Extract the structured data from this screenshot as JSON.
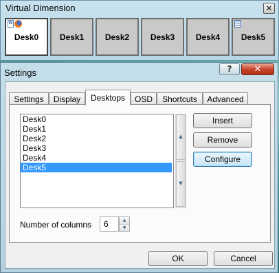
{
  "vd_window": {
    "title": "Virtual Dimension",
    "close_glyph": "✕",
    "desks": [
      {
        "label": "Desk0",
        "active": true
      },
      {
        "label": "Desk1",
        "active": false
      },
      {
        "label": "Desk2",
        "active": false
      },
      {
        "label": "Desk3",
        "active": false
      },
      {
        "label": "Desk4",
        "active": false
      },
      {
        "label": "Desk5",
        "active": false
      }
    ],
    "desk0_icons": [
      "document-icon",
      "firefox-icon"
    ],
    "desk5_icons": [
      "spreadsheet-icon"
    ]
  },
  "settings": {
    "title": "Settings",
    "help_glyph": "?",
    "close_glyph": "✕",
    "tabs": [
      {
        "label": "Settings"
      },
      {
        "label": "Display"
      },
      {
        "label": "Desktops",
        "active": true
      },
      {
        "label": "OSD"
      },
      {
        "label": "Shortcuts"
      },
      {
        "label": "Advanced"
      }
    ],
    "desktops_list": [
      "Desk0",
      "Desk1",
      "Desk2",
      "Desk3",
      "Desk4",
      "Desk5"
    ],
    "selected_desktop": "Desk5",
    "insert_label": "Insert",
    "remove_label": "Remove",
    "configure_label": "Configure",
    "columns_label": "Number of columns",
    "columns_value": "6",
    "ok_label": "OK",
    "cancel_label": "Cancel",
    "scroll_up_glyph": "▲",
    "scroll_down_glyph": "▼",
    "spin_up_glyph": "▲",
    "spin_down_glyph": "▼"
  },
  "colors": {
    "selection": "#3399ff",
    "close_button": "#c7442b",
    "titlebar": "#c4dfe9"
  }
}
